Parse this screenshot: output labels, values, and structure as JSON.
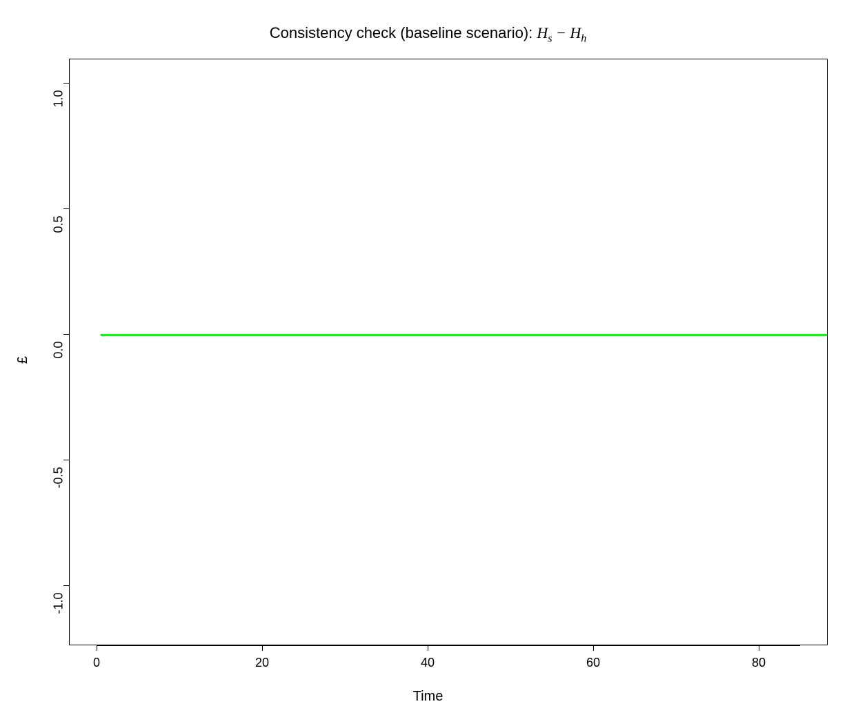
{
  "chart_data": {
    "type": "line",
    "title_parts": {
      "prefix": "Consistency check (baseline scenario): ",
      "var1": "H",
      "sub1": "s",
      "minus": " − ",
      "var2": "H",
      "sub2": "h"
    },
    "xlabel": "Time",
    "ylabel": "£",
    "xlim": [
      0,
      90
    ],
    "ylim": [
      -1.0,
      1.0
    ],
    "x_ticks": [
      0,
      20,
      40,
      60,
      80
    ],
    "y_ticks": [
      -1.0,
      -0.5,
      0.0,
      0.5,
      1.0
    ],
    "y_tick_labels": [
      "-1.0",
      "-0.5",
      "0.0",
      "0.5",
      "1.0"
    ],
    "series": [
      {
        "name": "Hs-Hh",
        "color": "#00ff00",
        "x": [
          2,
          3,
          4,
          5,
          6,
          7,
          8,
          9,
          10,
          15,
          20,
          25,
          30,
          35,
          40,
          45,
          50,
          55,
          60,
          65,
          70,
          75,
          80,
          85,
          90
        ],
        "values": [
          0,
          0,
          0,
          0,
          0,
          0,
          0,
          0,
          0,
          0,
          0,
          0,
          0,
          0,
          0,
          0,
          0,
          0,
          0,
          0,
          0,
          0,
          0,
          0,
          0
        ]
      }
    ]
  }
}
